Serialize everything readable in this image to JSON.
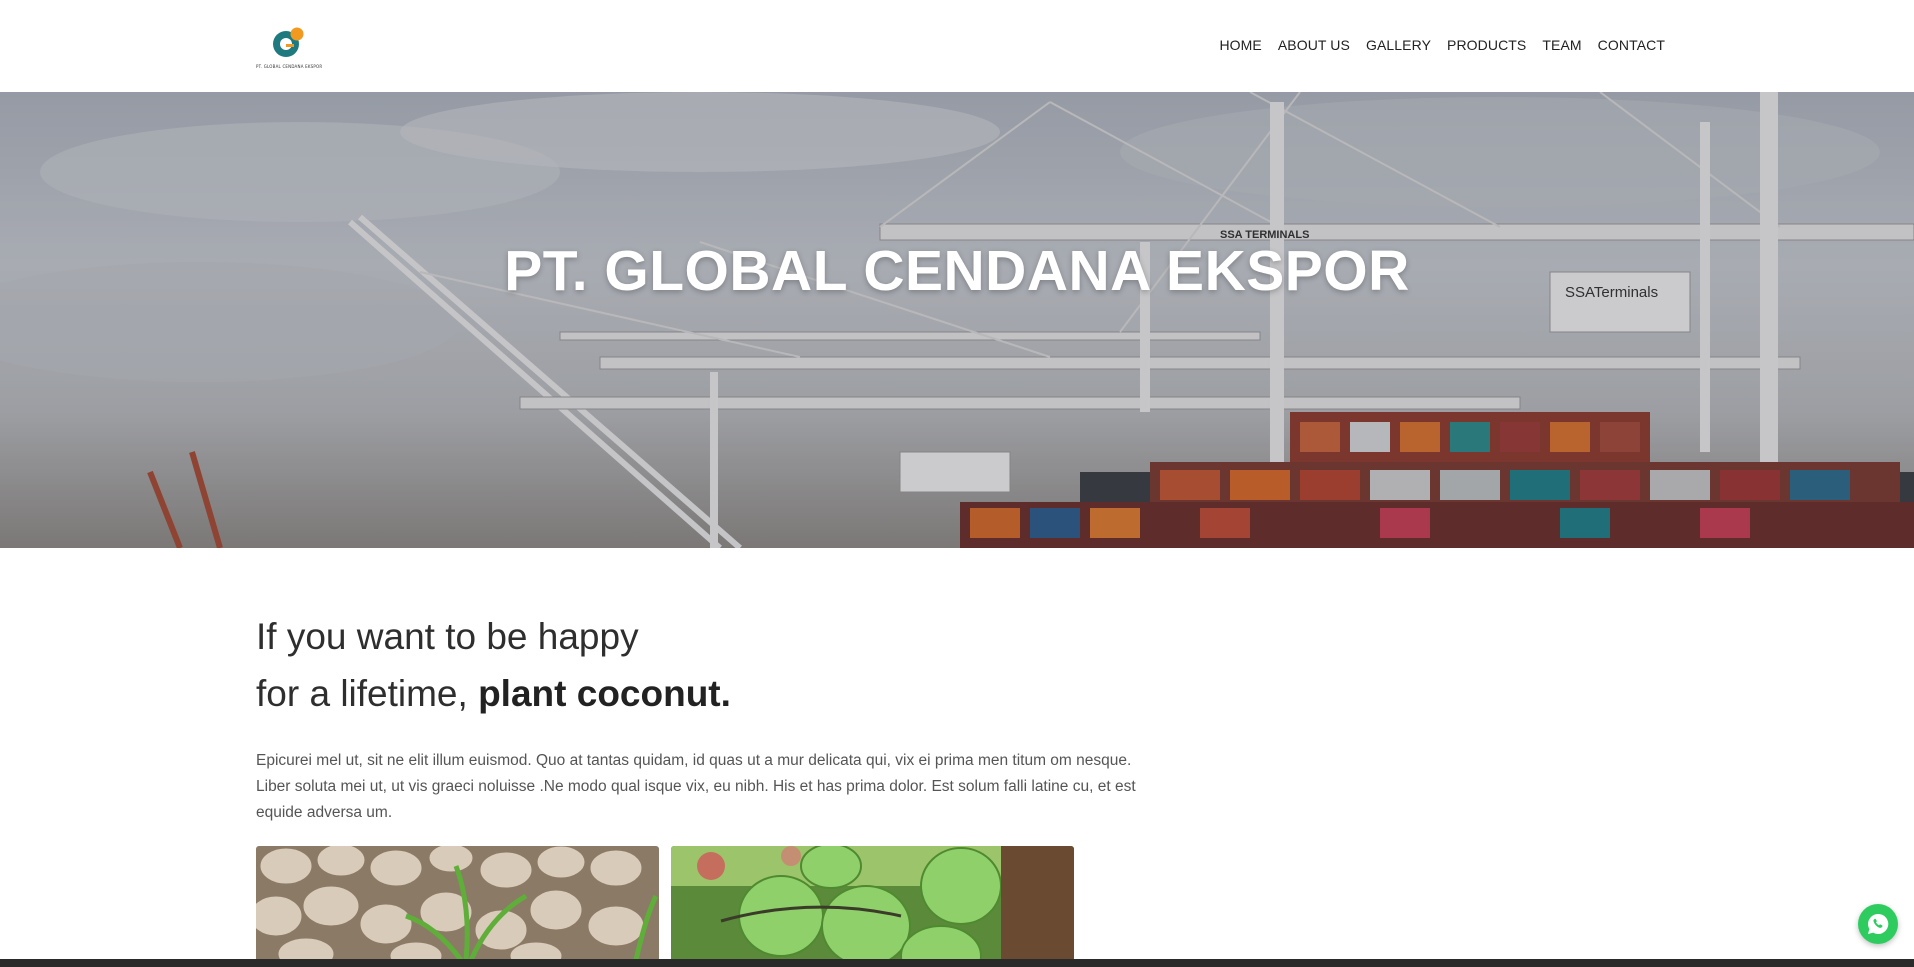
{
  "brand": {
    "logo_text": "PT. GLOBAL CENDANA EKSPOR",
    "accent": "#f29a1f",
    "logo_teal": "#1f7a80"
  },
  "nav": {
    "items": [
      {
        "label": "HOME"
      },
      {
        "label": "ABOUT US"
      },
      {
        "label": "GALLERY"
      },
      {
        "label": "PRODUCTS"
      },
      {
        "label": "TEAM"
      },
      {
        "label": "CONTACT"
      }
    ]
  },
  "hero": {
    "title": "PT. GLOBAL CENDANA EKSPOR",
    "crane_label_1": "SSA TERMINALS",
    "crane_label_2": "SSATerminals"
  },
  "intro": {
    "headline_line1": "If you want to be happy",
    "headline_line2_prefix": "for a lifetime, ",
    "headline_line2_bold": "plant coconut.",
    "body": "Epicurei mel ut, sit ne elit illum euismod. Quo at tantas quidam, id quas ut a mur delicata qui, vix ei prima men titum om nesque. Liber soluta mei ut, ut vis graeci noluisse .Ne modo qual isque vix, eu nibh. His et has prima dolor. Est solum falli latine cu, et est equide adversa um."
  },
  "floating": {
    "whatsapp_icon": "whatsapp-icon",
    "whatsapp_color": "#2ecc5f"
  }
}
